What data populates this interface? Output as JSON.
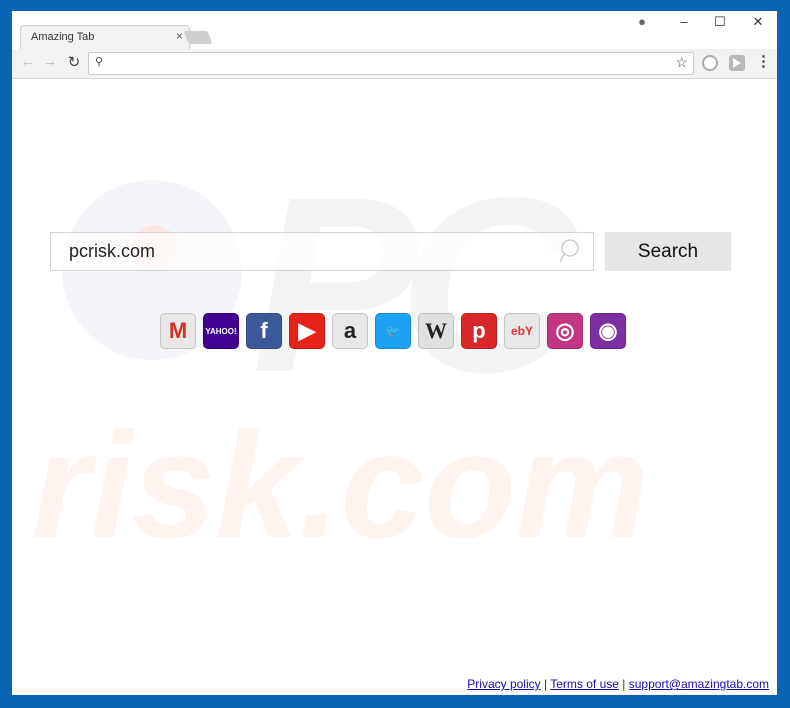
{
  "browser": {
    "tab_title": "Amazing Tab",
    "tab_close": "×",
    "address_value": "",
    "window_controls": {
      "account": "●",
      "minimize": "–",
      "maximize": "☐",
      "close": "✕"
    },
    "nav": {
      "back": "←",
      "forward": "→",
      "reload": "↻"
    },
    "omnibox_icon": "⚲",
    "bookmark_star": "☆",
    "menu": "⋮"
  },
  "search": {
    "query": "pcrisk.com",
    "button_label": "Search"
  },
  "shortcuts": [
    {
      "name": "gmail",
      "glyph": "M",
      "bg": "#e8e8e8",
      "fg": "#d93025"
    },
    {
      "name": "yahoo",
      "glyph": "YAHOO!",
      "bg": "#400090",
      "fg": "#ffffff"
    },
    {
      "name": "facebook",
      "glyph": "f",
      "bg": "#3b5998",
      "fg": "#ffffff"
    },
    {
      "name": "youtube",
      "glyph": "▶",
      "bg": "#e62117",
      "fg": "#ffffff"
    },
    {
      "name": "amazon",
      "glyph": "a",
      "bg": "#e8e8e8",
      "fg": "#222222"
    },
    {
      "name": "twitter",
      "glyph": "🐦",
      "bg": "#1da1f2",
      "fg": "#ffffff"
    },
    {
      "name": "wikipedia",
      "glyph": "W",
      "bg": "#e0e0e0",
      "fg": "#222222"
    },
    {
      "name": "pinterest",
      "glyph": "p",
      "bg": "#d9262a",
      "fg": "#ffffff"
    },
    {
      "name": "ebay",
      "glyph": "ebY",
      "bg": "#e8e8e8",
      "fg": "#e53238"
    },
    {
      "name": "instagram",
      "glyph": "◎",
      "bg": "#c13584",
      "fg": "#ffffff"
    },
    {
      "name": "podcasts",
      "glyph": "◉",
      "bg": "#7b2fa0",
      "fg": "#ffffff"
    }
  ],
  "footer": {
    "privacy": "Privacy policy",
    "sep1": "|",
    "terms": "Terms of use",
    "sep2": "|",
    "support": "support@amazingtab.com"
  },
  "watermark": {
    "top": "PC",
    "bottom": "risk.com"
  }
}
